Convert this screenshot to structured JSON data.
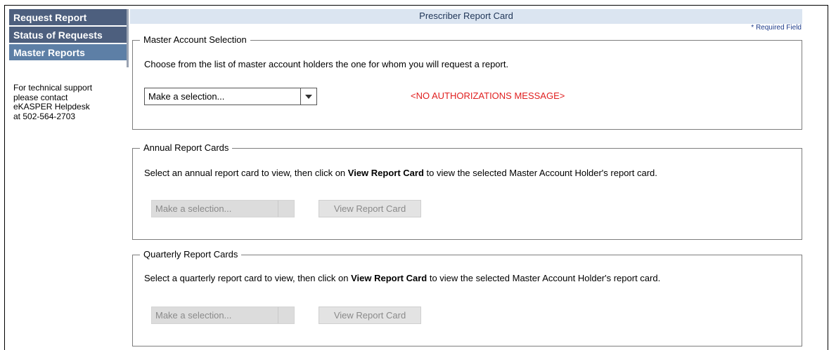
{
  "nav": {
    "items": [
      {
        "label": "Request Report"
      },
      {
        "label": "Status of Requests"
      },
      {
        "label": "Master Reports"
      }
    ]
  },
  "support": {
    "line1": "For technical support",
    "line2": "please contact",
    "line3": "eKASPER Helpdesk",
    "line4": "at 502-564-2703"
  },
  "header": {
    "title": "Prescriber Report Card",
    "required_note": "* Required Field"
  },
  "master": {
    "legend": "Master Account Selection",
    "description": "Choose from the list of master account holders the one for whom you will request a report.",
    "select_value": "Make a selection...",
    "message": "<NO AUTHORIZATIONS MESSAGE>"
  },
  "annual": {
    "legend": "Annual Report Cards",
    "desc_before": "Select an annual report card to view, then click on ",
    "desc_bold": "View Report Card",
    "desc_after": " to view the selected Master Account Holder's report card.",
    "select_value": "Make a selection...",
    "button_label": "View Report Card"
  },
  "quarterly": {
    "legend": "Quarterly Report Cards",
    "desc_before": "Select a quarterly report card to view, then click on ",
    "desc_bold": "View Report Card",
    "desc_after": " to view the selected Master Account Holder's report card.",
    "select_value": "Make a selection...",
    "button_label": "View Report Card"
  },
  "colors": {
    "nav_bg": "#4d5f7e",
    "nav_active": "#5d7fa6",
    "header_bg": "#dbe5f1",
    "error_text": "#e02020"
  }
}
